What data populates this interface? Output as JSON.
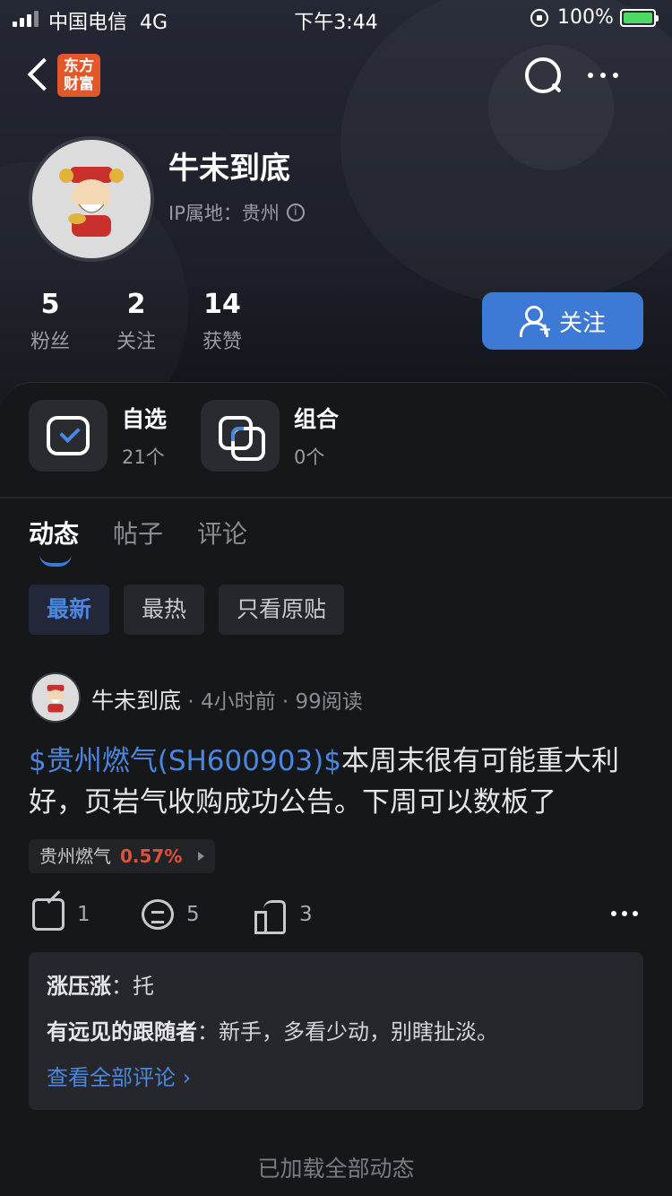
{
  "status_bar": {
    "carrier": "中国电信",
    "network": "4G",
    "time": "下午3:44",
    "battery": "100%"
  },
  "nav": {
    "logo_line1": "东方",
    "logo_line2": "财富",
    "logo_color": "#e2582a"
  },
  "profile": {
    "username": "牛未到底",
    "ip_label": "IP属地：贵州",
    "stats": [
      {
        "num": "5",
        "label": "粉丝"
      },
      {
        "num": "2",
        "label": "关注"
      },
      {
        "num": "14",
        "label": "获赞"
      }
    ],
    "follow_label": "关注",
    "follow_color": "#3c7ad6"
  },
  "quick_links": [
    {
      "title": "自选",
      "count": "21个",
      "icon": "checkbox-icon"
    },
    {
      "title": "组合",
      "count": "0个",
      "icon": "portfolio-icon"
    }
  ],
  "tabs": [
    "动态",
    "帖子",
    "评论"
  ],
  "active_tab": "动态",
  "filters": [
    "最新",
    "最热",
    "只看原贴"
  ],
  "active_filter": "最新",
  "post": {
    "author": "牛未到底",
    "time": "4小时前",
    "reads": "99阅读",
    "stock_tag": "$贵州燃气(SH600903)$",
    "body": "本周末很有可能重大利好，页岩气收购成功公告。下周可以数板了",
    "ticker_name": "贵州燃气",
    "ticker_change": "0.57%",
    "shares": "1",
    "comments": "5",
    "likes": "3"
  },
  "comments": [
    {
      "name": "涨压涨",
      "sep": "：",
      "text": "托"
    },
    {
      "name": "有远见的跟随者",
      "sep": "：",
      "text": "新手，多看少动，别瞎扯淡。"
    }
  ],
  "see_all": "查看全部评论 ›",
  "footer": "已加载全部动态",
  "colors": {
    "accent": "#4a87e0",
    "up": "#e0503a",
    "background": "#161719"
  }
}
